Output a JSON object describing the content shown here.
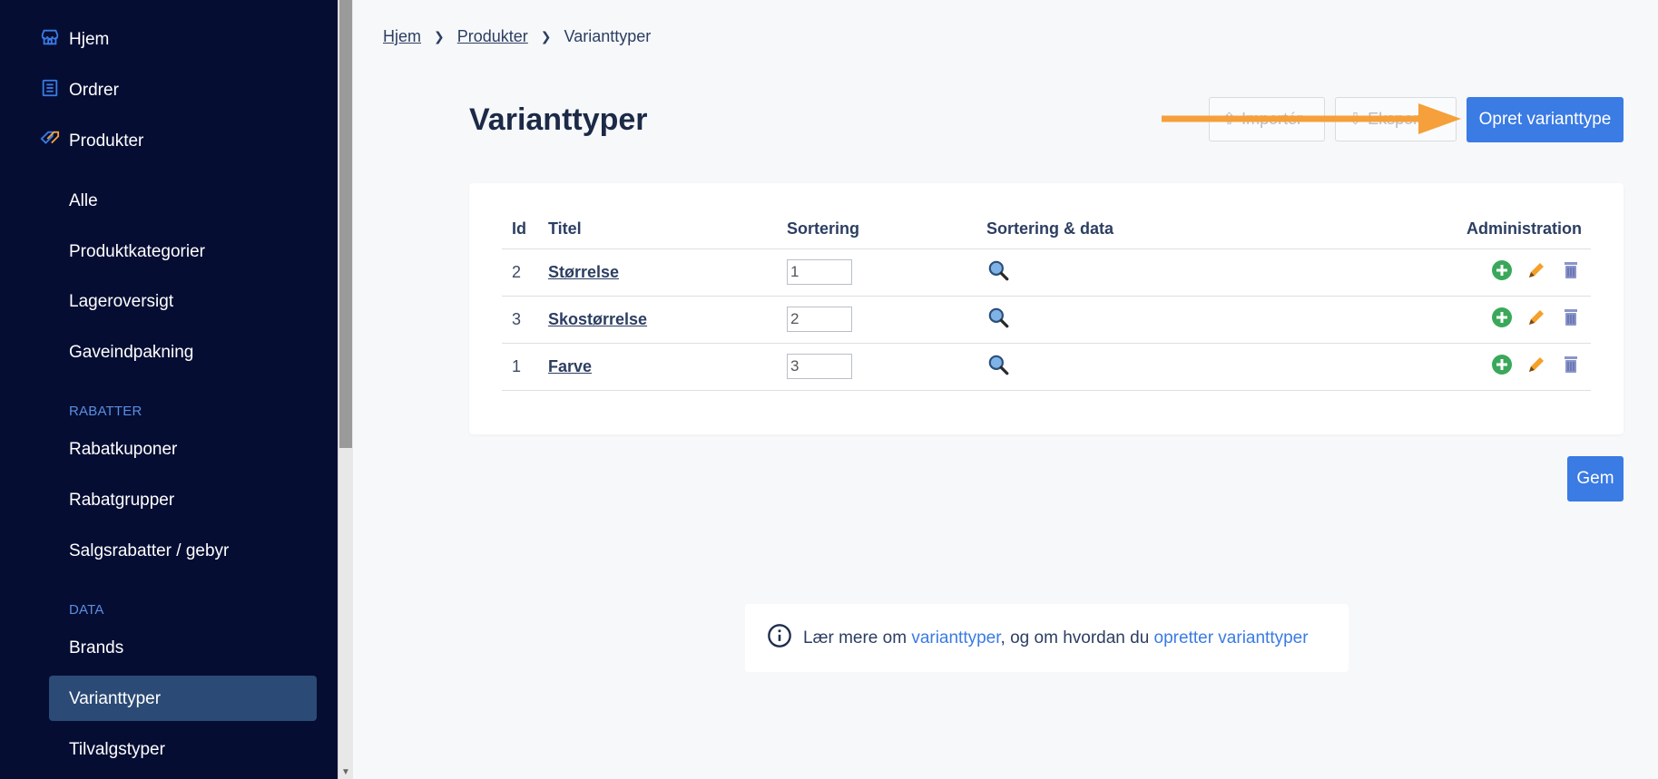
{
  "sidebar": {
    "top_items": [
      {
        "label": "Hjem",
        "icon": "store-icon"
      },
      {
        "label": "Ordrer",
        "icon": "list-icon"
      },
      {
        "label": "Produkter",
        "icon": "tag-icon"
      }
    ],
    "sub_items": [
      "Alle",
      "Produktkategorier",
      "Lageroversigt",
      "Gaveindpakning"
    ],
    "sections": [
      {
        "title": "RABATTER",
        "items": [
          "Rabatkuponer",
          "Rabatgrupper",
          "Salgsrabatter / gebyr"
        ]
      },
      {
        "title": "DATA",
        "items": [
          "Brands",
          "Varianttyper",
          "Tilvalgstyper"
        ]
      }
    ],
    "active_item": "Varianttyper"
  },
  "breadcrumb": {
    "items": [
      "Hjem",
      "Produkter",
      "Varianttyper"
    ]
  },
  "page": {
    "title": "Varianttyper"
  },
  "toolbar": {
    "import_label": "Importér",
    "export_label": "Eksportér",
    "create_label": "Opret varianttype"
  },
  "table": {
    "headers": [
      "Id",
      "Titel",
      "Sortering",
      "Sortering & data",
      "Administration"
    ],
    "rows": [
      {
        "id": "2",
        "title": "Størrelse",
        "sort": "1"
      },
      {
        "id": "3",
        "title": "Skostørrelse",
        "sort": "2"
      },
      {
        "id": "1",
        "title": "Farve",
        "sort": "3"
      }
    ]
  },
  "save_label": "Gem",
  "info": {
    "prefix": "Lær mere om",
    "link1": "varianttyper",
    "middle": ", og om hvordan du",
    "link2": "opretter varianttyper"
  },
  "colors": {
    "sidebar_bg": "#050d33",
    "accent": "#3a7be4",
    "active_bg": "#2b4a75",
    "arrow": "#f5a03a"
  }
}
